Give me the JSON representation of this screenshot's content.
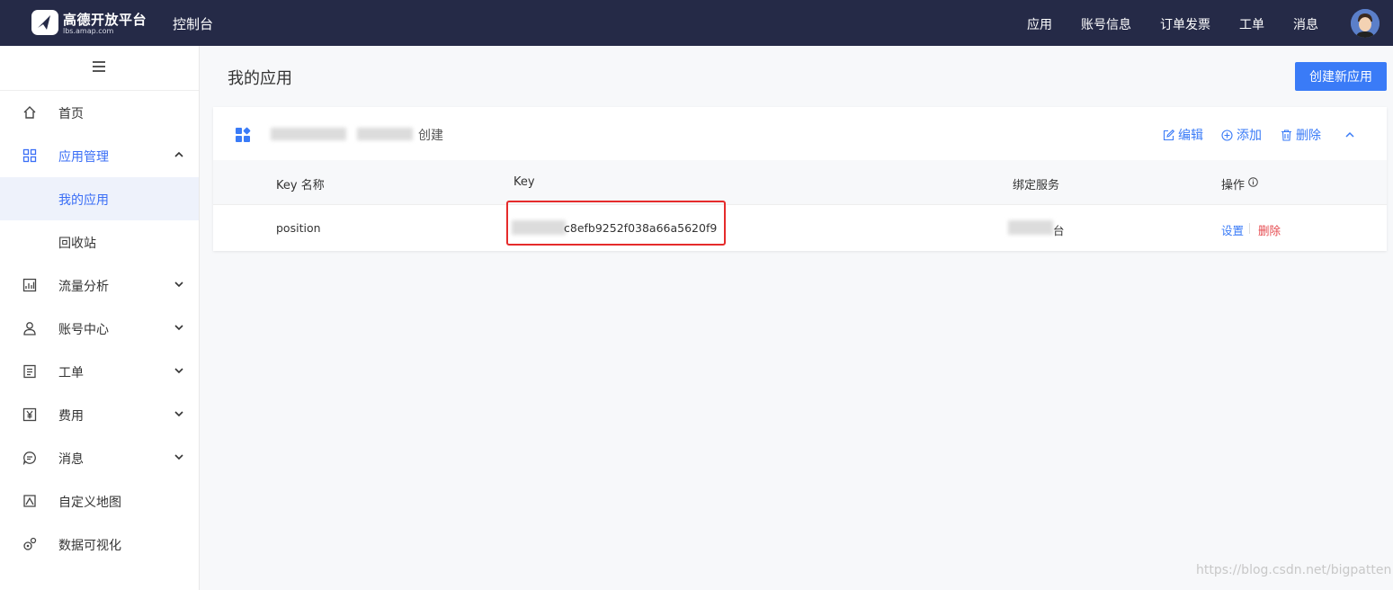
{
  "header": {
    "brand": "高德开放平台",
    "brand_sub": "lbs.amap.com",
    "console": "控制台",
    "nav": [
      "应用",
      "账号信息",
      "订单发票",
      "工单",
      "消息"
    ]
  },
  "sidebar": {
    "items": [
      {
        "label": "首页",
        "icon": "home-icon"
      },
      {
        "label": "应用管理",
        "icon": "grid-icon",
        "expanded": true
      },
      {
        "label": "我的应用",
        "sub": true,
        "selected": true
      },
      {
        "label": "回收站",
        "sub": true
      },
      {
        "label": "流量分析",
        "icon": "chart-icon"
      },
      {
        "label": "账号中心",
        "icon": "user-icon"
      },
      {
        "label": "工单",
        "icon": "ticket-icon"
      },
      {
        "label": "费用",
        "icon": "yen-icon"
      },
      {
        "label": "消息",
        "icon": "message-icon"
      },
      {
        "label": "自定义地图",
        "icon": "map-icon"
      },
      {
        "label": "数据可视化",
        "icon": "visual-icon"
      }
    ]
  },
  "main": {
    "title": "我的应用",
    "create_button": "创建新应用",
    "app_card": {
      "created_suffix": "创建",
      "actions": {
        "edit": "编辑",
        "add": "添加",
        "delete": "删除"
      },
      "columns": {
        "key_name": "Key 名称",
        "key": "Key",
        "bound_service": "绑定服务",
        "operation": "操作"
      },
      "rows": [
        {
          "key_name": "position",
          "key_visible": "c8efb9252f038a66a5620f9",
          "bound_service_visible": "台",
          "ops": {
            "settings": "设置",
            "delete": "删除"
          }
        }
      ]
    }
  },
  "watermark": "https://blog.csdn.net/bigpatten",
  "colors": {
    "topbar": "#252a47",
    "accent": "#3a7bf7",
    "danger": "#e5484d",
    "highlight": "#e52b2b"
  }
}
